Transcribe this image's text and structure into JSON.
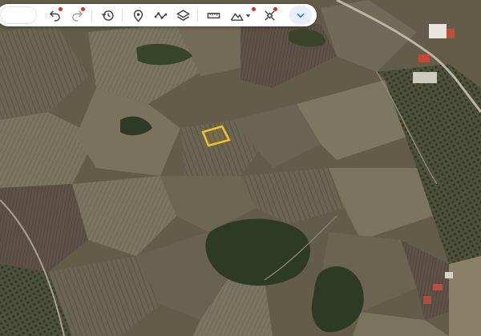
{
  "colors": {
    "accent": "#1a73e8",
    "icon": "#3c4043",
    "indicator_dot": "#d93025",
    "selection_outline": "#f2c12e"
  },
  "toolbar": {
    "search_placeholder": "",
    "tools": [
      {
        "name": "undo-icon",
        "has_indicator": true
      },
      {
        "name": "redo-icon",
        "has_indicator": true,
        "disabled": true
      },
      {
        "name": "history-icon"
      },
      {
        "name": "placemark-icon"
      },
      {
        "name": "path-icon"
      },
      {
        "name": "layers-icon"
      },
      {
        "name": "ruler-icon"
      },
      {
        "name": "terrain-icon",
        "has_dropdown": true,
        "has_indicator": true
      },
      {
        "name": "satellite-tools-icon",
        "has_indicator": true
      },
      {
        "name": "chevron-down-icon"
      }
    ]
  },
  "map": {
    "type": "satellite",
    "selected_region": "highlighted-parcel"
  }
}
